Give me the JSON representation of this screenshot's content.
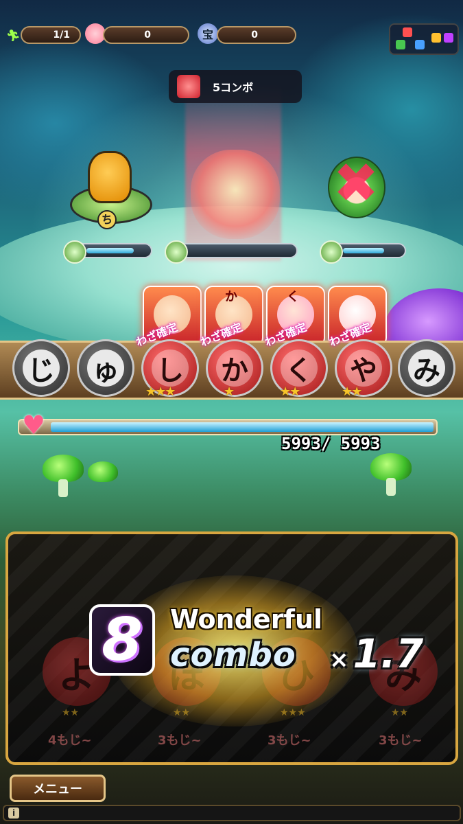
{
  "topbar": {
    "runner_count": "1/1",
    "peach_count": "0",
    "treasure_count": "0",
    "treasure_icon_label": "宝"
  },
  "combo_banner": {
    "text": "5コンボ"
  },
  "enemies": [
    {
      "name_icon": "ち",
      "hp_fraction": 0.78
    },
    {
      "hp_fraction": 0.0
    },
    {
      "hp_fraction": 0.72
    }
  ],
  "party": {
    "waza_label": "わざ確定",
    "member_badges": [
      "",
      "か",
      "く",
      ""
    ]
  },
  "letters": [
    "じ",
    "ゅ",
    "し",
    "か",
    "く",
    "や",
    "み"
  ],
  "player_hp": {
    "text": "5993/ 5993",
    "fraction": 1.0
  },
  "combo_panel": {
    "combo_count": "8",
    "rating": "Wonderful",
    "combo_word": "combo",
    "multiplier_x": "×",
    "multiplier": "1.7",
    "slots": [
      {
        "letter": "よ",
        "min_text": "4もじ~"
      },
      {
        "letter": "ほ",
        "min_text": "3もじ~"
      },
      {
        "letter": "ひ",
        "min_text": "3もじ~"
      },
      {
        "letter": "み",
        "min_text": "3もじ~"
      }
    ]
  },
  "menu": {
    "label": "メニュー"
  },
  "info": {
    "icon": "i"
  },
  "colors": {
    "gold_border": "#d8a640",
    "hp_blue": "#1f9fd6",
    "panel_bg": "#0b0b0b"
  }
}
